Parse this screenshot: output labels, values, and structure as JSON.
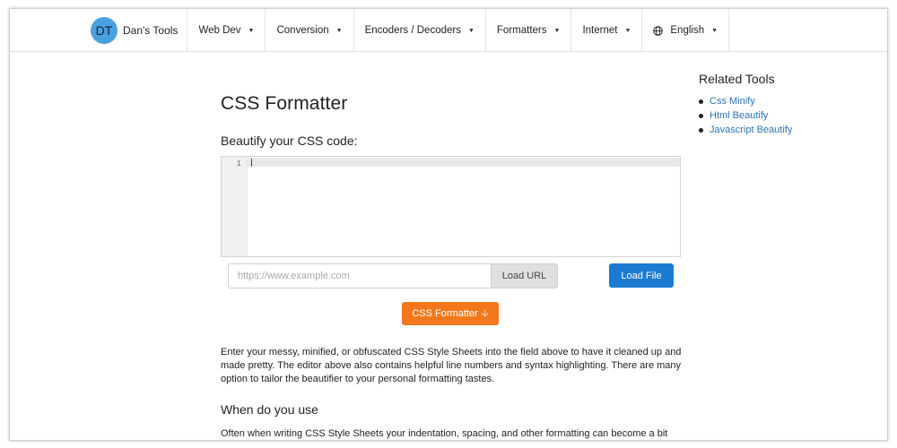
{
  "nav": {
    "brand_logo": "DT",
    "brand_name": "Dan's Tools",
    "items": [
      {
        "label": "Web Dev"
      },
      {
        "label": "Conversion"
      },
      {
        "label": "Encoders / Decoders"
      },
      {
        "label": "Formatters"
      },
      {
        "label": "Internet"
      }
    ],
    "language": "English"
  },
  "main": {
    "title": "CSS Formatter",
    "subtitle": "Beautify your CSS code:",
    "editor": {
      "line_number": "1",
      "content": ""
    },
    "url_placeholder": "https://www.example.com",
    "load_url_label": "Load URL",
    "load_file_label": "Load File",
    "format_label": "CSS Formatter",
    "description": "Enter your messy, minified, or obfuscated CSS Style Sheets into the field above to have it cleaned up and made pretty. The editor above also contains helpful line numbers and syntax highlighting. There are many option to tailor the beautifier to your personal formatting tastes.",
    "section_heading": "When do you use",
    "section_text": "Often when writing CSS Style Sheets your indentation, spacing, and other formatting can become a bit"
  },
  "sidebar": {
    "title": "Related Tools",
    "links": [
      {
        "label": "Css Minify"
      },
      {
        "label": "Html Beautify"
      },
      {
        "label": "Javascript Beautify"
      }
    ]
  },
  "colors": {
    "primary": "#1a7bd1",
    "accent": "#f3781c",
    "link": "#2a73b8",
    "logo": "#4a9fe0"
  }
}
